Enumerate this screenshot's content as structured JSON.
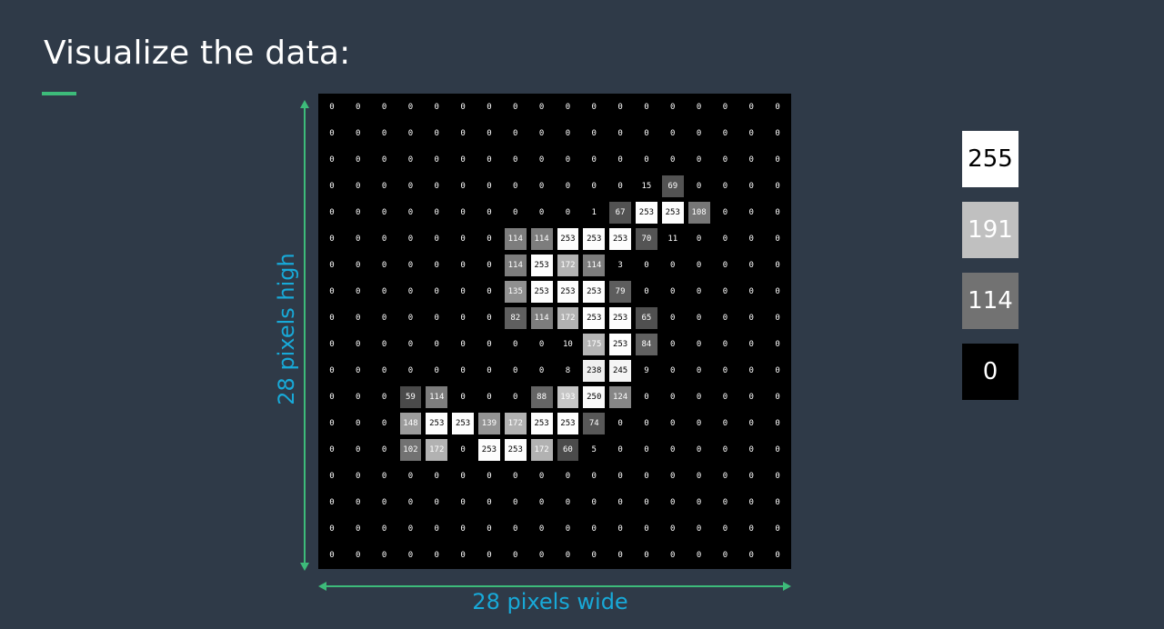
{
  "title": "Visualize the data:",
  "axis_labels": {
    "height": "28 pixels high",
    "width": "28 pixels wide"
  },
  "colors": {
    "background": "#2f3a48",
    "accent_underline": "#3dbb7a",
    "arrow_vertical": "#3dbb7a",
    "arrow_horizontal": "#3dbb7a",
    "label_text": "#18a9d8"
  },
  "legend": [
    {
      "value": "255",
      "bg": "#ffffff",
      "fg": "#000000"
    },
    {
      "value": "191",
      "bg": "#c0c0c0",
      "fg": "#ffffff"
    },
    {
      "value": "114",
      "bg": "#727272",
      "fg": "#ffffff"
    },
    {
      "value": "0",
      "bg": "#000000",
      "fg": "#ffffff"
    }
  ],
  "grid": [
    [
      0,
      0,
      0,
      0,
      0,
      0,
      0,
      0,
      0,
      0,
      0,
      0,
      0,
      0,
      0,
      0,
      0,
      0
    ],
    [
      0,
      0,
      0,
      0,
      0,
      0,
      0,
      0,
      0,
      0,
      0,
      0,
      0,
      0,
      0,
      0,
      0,
      0
    ],
    [
      0,
      0,
      0,
      0,
      0,
      0,
      0,
      0,
      0,
      0,
      0,
      0,
      0,
      0,
      0,
      0,
      0,
      0
    ],
    [
      0,
      0,
      0,
      0,
      0,
      0,
      0,
      0,
      0,
      0,
      0,
      0,
      15,
      69,
      0,
      0,
      0,
      0
    ],
    [
      0,
      0,
      0,
      0,
      0,
      0,
      0,
      0,
      0,
      0,
      1,
      67,
      253,
      253,
      108,
      0,
      0,
      0
    ],
    [
      0,
      0,
      0,
      0,
      0,
      0,
      0,
      114,
      114,
      253,
      253,
      253,
      70,
      11,
      0,
      0,
      0,
      0
    ],
    [
      0,
      0,
      0,
      0,
      0,
      0,
      0,
      114,
      253,
      172,
      114,
      3,
      0,
      0,
      0,
      0,
      0,
      0
    ],
    [
      0,
      0,
      0,
      0,
      0,
      0,
      0,
      135,
      253,
      253,
      253,
      79,
      0,
      0,
      0,
      0,
      0,
      0
    ],
    [
      0,
      0,
      0,
      0,
      0,
      0,
      0,
      82,
      114,
      172,
      253,
      253,
      65,
      0,
      0,
      0,
      0,
      0
    ],
    [
      0,
      0,
      0,
      0,
      0,
      0,
      0,
      0,
      0,
      10,
      175,
      253,
      84,
      0,
      0,
      0,
      0,
      0
    ],
    [
      0,
      0,
      0,
      0,
      0,
      0,
      0,
      0,
      0,
      8,
      238,
      245,
      9,
      0,
      0,
      0,
      0,
      0
    ],
    [
      0,
      0,
      0,
      59,
      114,
      0,
      0,
      0,
      88,
      193,
      250,
      124,
      0,
      0,
      0,
      0,
      0,
      0
    ],
    [
      0,
      0,
      0,
      148,
      253,
      253,
      139,
      172,
      253,
      253,
      74,
      0,
      0,
      0,
      0,
      0,
      0,
      0
    ],
    [
      0,
      0,
      0,
      102,
      172,
      0,
      253,
      253,
      172,
      60,
      5,
      0,
      0,
      0,
      0,
      0,
      0,
      0
    ],
    [
      0,
      0,
      0,
      0,
      0,
      0,
      0,
      0,
      0,
      0,
      0,
      0,
      0,
      0,
      0,
      0,
      0,
      0
    ],
    [
      0,
      0,
      0,
      0,
      0,
      0,
      0,
      0,
      0,
      0,
      0,
      0,
      0,
      0,
      0,
      0,
      0,
      0
    ],
    [
      0,
      0,
      0,
      0,
      0,
      0,
      0,
      0,
      0,
      0,
      0,
      0,
      0,
      0,
      0,
      0,
      0,
      0
    ],
    [
      0,
      0,
      0,
      0,
      0,
      0,
      0,
      0,
      0,
      0,
      0,
      0,
      0,
      0,
      0,
      0,
      0,
      0
    ]
  ]
}
